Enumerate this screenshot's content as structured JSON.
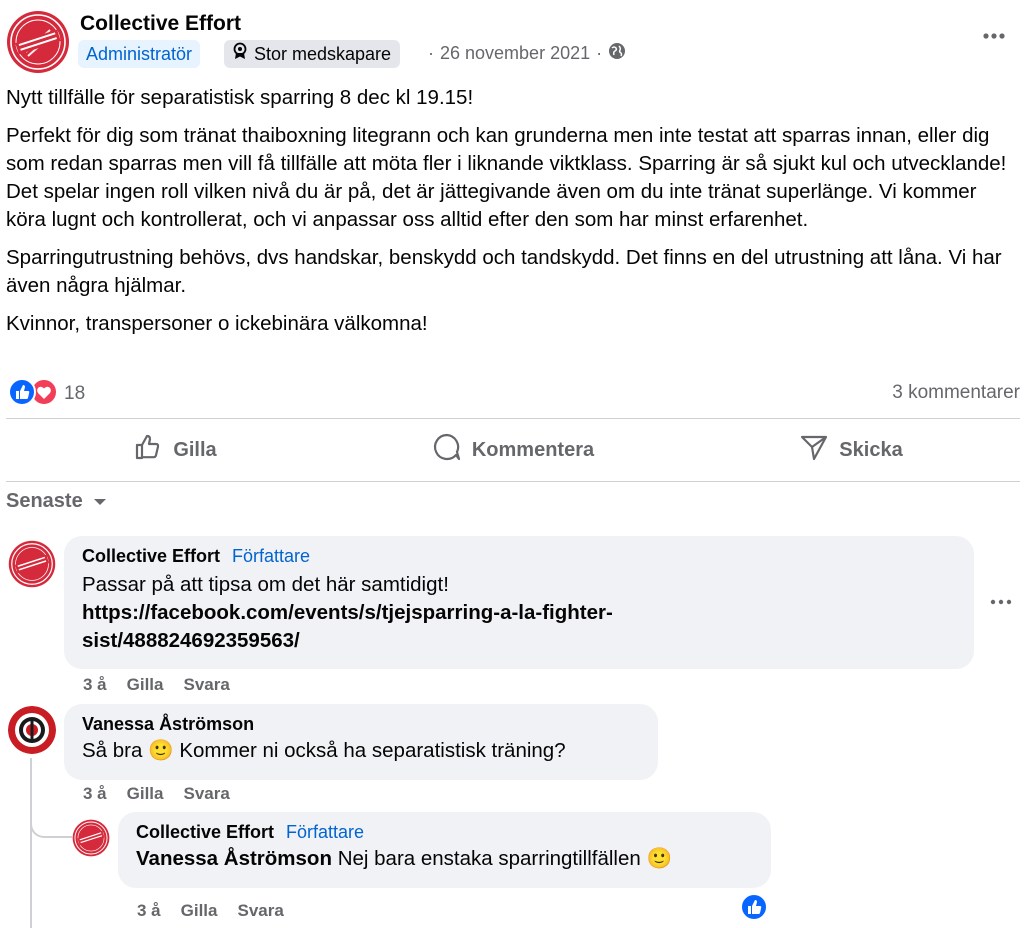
{
  "post": {
    "page_name": "Collective Effort",
    "role_badge": "Administratör",
    "contributor_badge": "Stor medskapare",
    "date": "26 november 2021",
    "separator": "·",
    "paragraphs": [
      "Nytt tillfälle för separatistisk sparring 8 dec kl 19.15!",
      "Perfekt för dig som tränat thaiboxning litegrann och kan grunderna men inte testat att sparras innan, eller dig som redan sparras men vill få tillfälle att möta fler i liknande viktklass. Sparring är så sjukt kul och utvecklande! Det spelar ingen roll vilken nivå du är på, det är jättegivande även om du inte tränat superlänge. Vi kommer köra lugnt och kontrollerat, och vi anpassar oss alltid efter den som har minst erfarenhet.",
      "Sparringutrustning behövs, dvs handskar, benskydd och tandskydd. Det finns en del utrustning att låna. Vi har även några hjälmar.",
      "Kvinnor, transpersoner o ickebinära välkomna!"
    ],
    "reaction_count": "18",
    "comments_count": "3 kommentarer"
  },
  "actions": {
    "like": "Gilla",
    "comment": "Kommentera",
    "send": "Skicka"
  },
  "sort_label": "Senaste",
  "comments": [
    {
      "name": "Collective Effort",
      "tag": "Författare",
      "text": "Passar på att tipsa om det här samtidigt!",
      "link_line1": "https://facebook.com/events/s/tjejsparring-a-la-fighter-",
      "link_line2": "sist/488824692359563/",
      "age": "3 å",
      "like": "Gilla",
      "reply": "Svara"
    },
    {
      "name": "Vanessa Åströmson",
      "text_before": "Så bra",
      "emoji": "🙂",
      "text_after": "Kommer ni också ha separatistisk träning?",
      "age": "3 å",
      "like": "Gilla",
      "reply": "Svara"
    },
    {
      "name": "Collective Effort",
      "tag": "Författare",
      "mention": "Vanessa Åströmson",
      "text": "Nej bara enstaka sparringtillfällen",
      "emoji": "🙂",
      "age": "3 å",
      "like": "Gilla",
      "reply": "Svara"
    }
  ],
  "icons": [
    "more-icon",
    "globe-icon",
    "badge-icon",
    "like-reaction-icon",
    "love-reaction-icon",
    "thumbs-up-icon",
    "comment-icon",
    "send-icon",
    "chevron-down-icon"
  ],
  "colors": {
    "accent": "#0866ff",
    "love": "#f33e58",
    "brand_red": "#d42a3b",
    "muted": "#65676b",
    "bubble": "#f0f2f5"
  }
}
